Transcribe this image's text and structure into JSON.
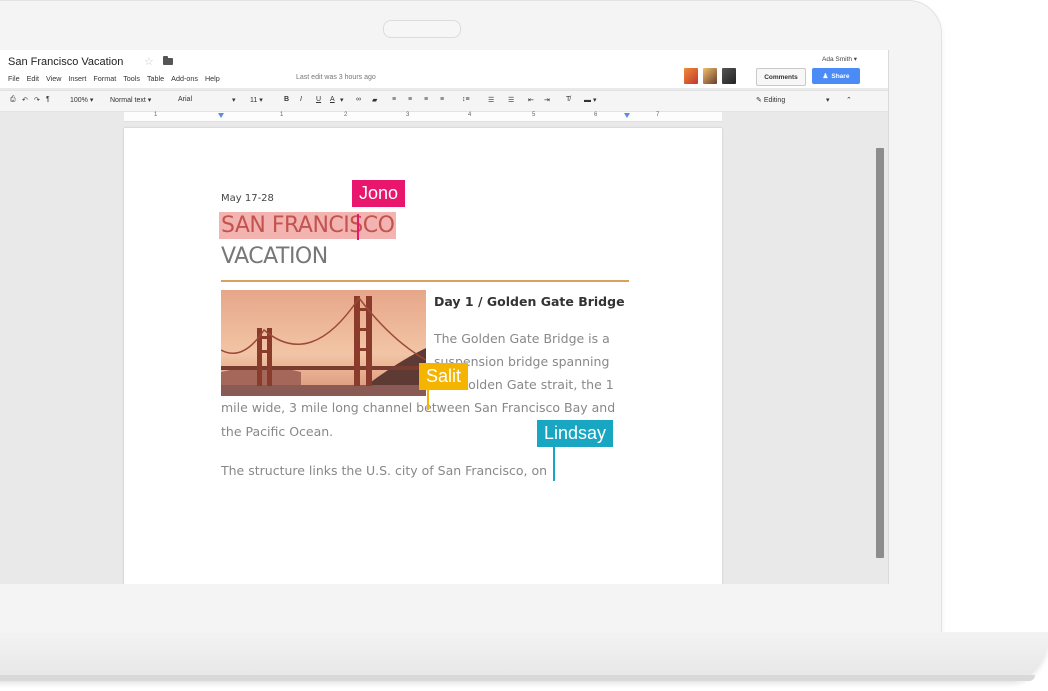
{
  "document": {
    "title": "San Francisco Vacation",
    "last_edit": "Last edit was 3 hours ago",
    "date": "May 17-28",
    "heading_line_1": "SAN FRANCISCO",
    "heading_line_2": "VACATION",
    "section_heading": "Day 1 / Golden Gate Bridge",
    "paragraph_lines": [
      "The Golden Gate Bridge is a",
      "suspension bridge spanning",
      "the Golden Gate strait, the 1",
      "mile wide, 3 mile long channel between San Francisco Bay and",
      "the Pacific Ocean."
    ],
    "paragraph_2": "The structure links the U.S. city of San Francisco, on"
  },
  "menu": [
    "File",
    "Edit",
    "View",
    "Insert",
    "Format",
    "Tools",
    "Table",
    "Add-ons",
    "Help"
  ],
  "header": {
    "user_name": "Ada Smith ▾",
    "comments_label": "Comments",
    "share_label": "Share"
  },
  "toolbar": {
    "zoom": "100%",
    "style": "Normal text",
    "font": "Arial",
    "size": "11",
    "bold": "B",
    "italic": "I",
    "underline": "U",
    "text_color": "A",
    "mode": "Editing"
  },
  "ruler": [
    "1",
    "1",
    "2",
    "3",
    "4",
    "5",
    "6",
    "7"
  ],
  "collaborators": [
    {
      "name": "Jono",
      "color": "#e8176d"
    },
    {
      "name": "Salit",
      "color": "#f5b400"
    },
    {
      "name": "Lindsay",
      "color": "#18a6c2"
    }
  ]
}
